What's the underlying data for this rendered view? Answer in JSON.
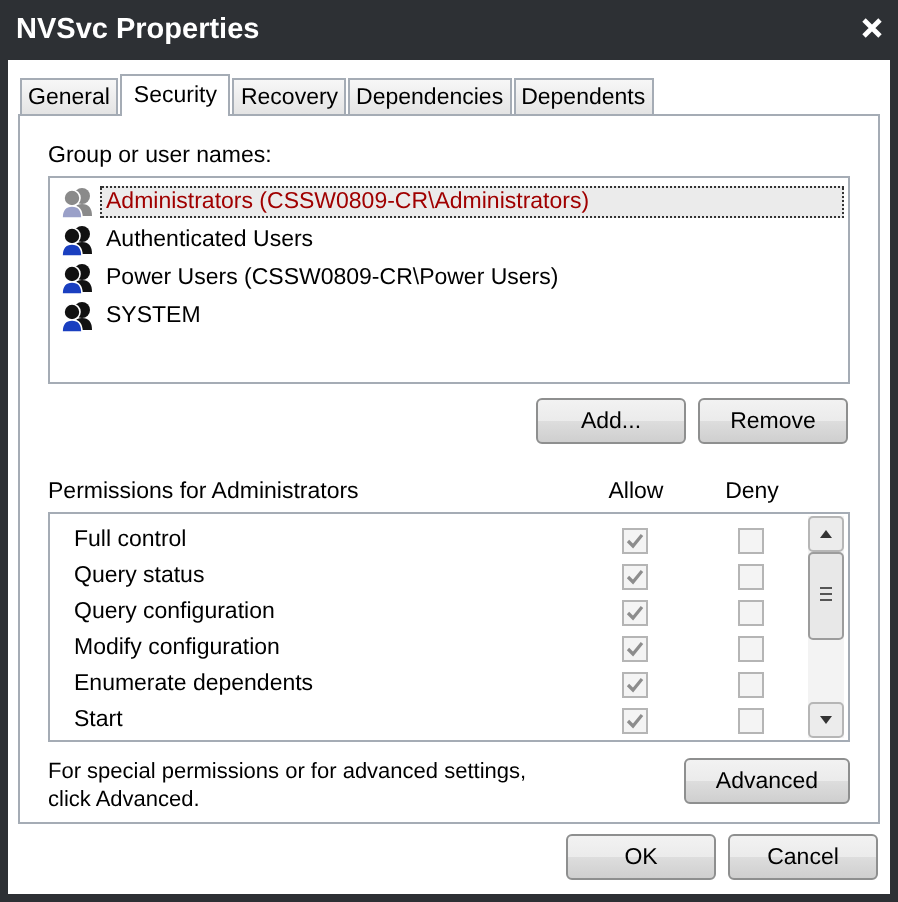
{
  "window": {
    "title": "NVSvc Properties"
  },
  "tabs": [
    {
      "label": "General",
      "selected": false
    },
    {
      "label": "Security",
      "selected": true
    },
    {
      "label": "Recovery",
      "selected": false
    },
    {
      "label": "Dependencies",
      "selected": false
    },
    {
      "label": "Dependents",
      "selected": false
    }
  ],
  "groups": {
    "label": "Group or user names:",
    "items": [
      {
        "name": "Administrators (CSSW0809-CR\\Administrators)",
        "selected": true
      },
      {
        "name": "Authenticated Users",
        "selected": false
      },
      {
        "name": "Power Users (CSSW0809-CR\\Power Users)",
        "selected": false
      },
      {
        "name": "SYSTEM",
        "selected": false
      }
    ]
  },
  "group_buttons": [
    "Add...",
    "Remove"
  ],
  "permissions": {
    "label": "Permissions for Administrators",
    "columns": [
      "Allow",
      "Deny"
    ],
    "disabled": true,
    "rows": [
      {
        "name": "Full control",
        "allow": true,
        "deny": false
      },
      {
        "name": "Query status",
        "allow": true,
        "deny": false
      },
      {
        "name": "Query configuration",
        "allow": true,
        "deny": false
      },
      {
        "name": "Modify configuration",
        "allow": true,
        "deny": false
      },
      {
        "name": "Enumerate dependents",
        "allow": true,
        "deny": false
      },
      {
        "name": "Start",
        "allow": true,
        "deny": false
      }
    ]
  },
  "advanced": {
    "note": "For special permissions or for advanced settings, click Advanced.",
    "button": "Advanced"
  },
  "buttons": [
    "OK",
    "Cancel"
  ]
}
